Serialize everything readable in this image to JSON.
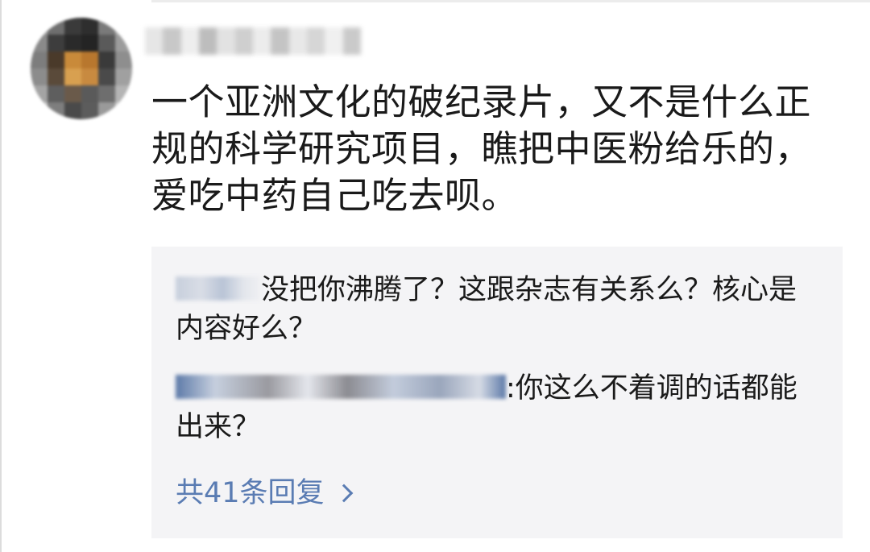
{
  "comment": {
    "avatar_icon": "user-avatar-pixelated",
    "text": "一个亚洲文化的破纪录片，又不是什么正规的科学研究项目，瞧把中医粉给乐的，爱吃中药自己吃去呗。"
  },
  "replies": [
    {
      "text": "没把你沸腾了？这跟杂志有关系么？核心是内容好么？"
    },
    {
      "text": ":你这么不着调的话都能出来？"
    }
  ],
  "view_all": {
    "label": "共41条回复",
    "icon": "chevron-right-icon"
  },
  "colors": {
    "link": "#5a7cb3",
    "panel_bg": "#f4f4f6",
    "text": "#1a1a1a"
  }
}
